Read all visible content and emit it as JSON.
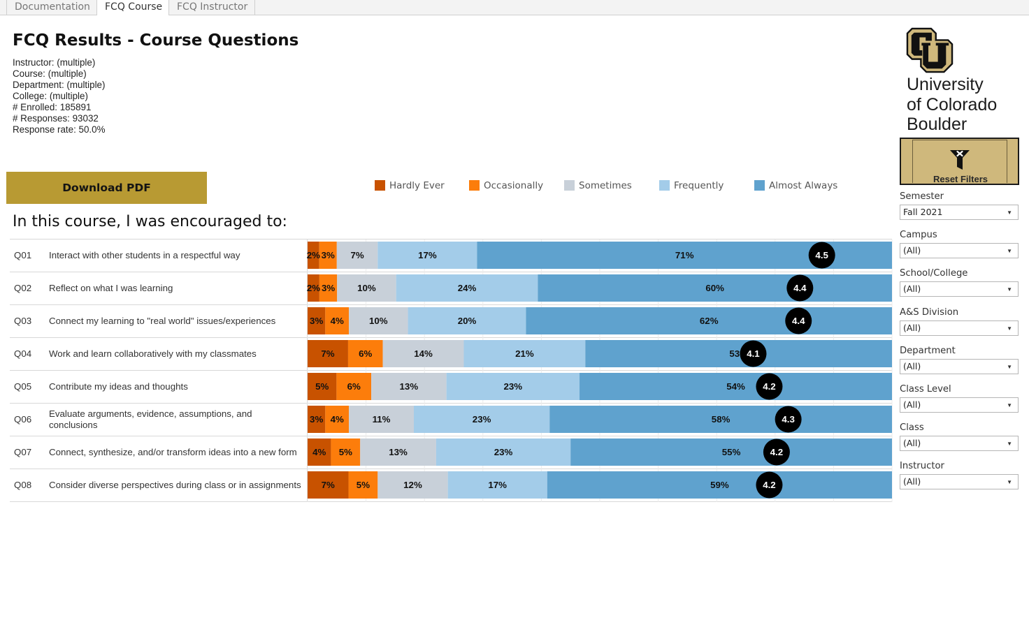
{
  "tabs": [
    {
      "label": "Documentation",
      "active": false
    },
    {
      "label": "FCQ Course",
      "active": true
    },
    {
      "label": "FCQ Instructor",
      "active": false
    }
  ],
  "header": {
    "title": "FCQ Results - Course Questions",
    "info": [
      "Instructor: (multiple)",
      "Course: (multiple)",
      "Department: (multiple)",
      "College: (multiple)",
      "# Enrolled: 185891",
      "# Responses: 93032",
      "Response rate: 50.0%"
    ]
  },
  "download_button": {
    "label": "Download PDF",
    "color": "#B89A33"
  },
  "section_heading": "In this course, I was encouraged to:",
  "logo": {
    "icon": "cu-logo-icon",
    "lines": [
      "University",
      "of Colorado",
      "Boulder"
    ]
  },
  "reset_button": {
    "label": "Reset Filters",
    "icon": "filter-clear-icon",
    "color": "#CFB87C"
  },
  "filters": [
    {
      "label": "Semester",
      "value": "Fall 2021"
    },
    {
      "label": "Campus",
      "value": "(All)"
    },
    {
      "label": "School/College",
      "value": "(All)"
    },
    {
      "label": "A&S Division",
      "value": "(All)"
    },
    {
      "label": "Department",
      "value": "(All)"
    },
    {
      "label": "Class Level",
      "value": "(All)"
    },
    {
      "label": "Class",
      "value": "(All)"
    },
    {
      "label": "Instructor",
      "value": "(All)"
    }
  ],
  "chart_data": {
    "type": "bar",
    "orientation": "horizontal",
    "stacked": true,
    "title": "In this course, I was encouraged to:",
    "xlabel": "",
    "ylabel": "",
    "xlim": [
      0,
      100
    ],
    "grid": true,
    "grid_step": 10,
    "legend": {
      "position": "top"
    },
    "categories": [
      "Q01",
      "Q02",
      "Q03",
      "Q04",
      "Q05",
      "Q06",
      "Q07",
      "Q08"
    ],
    "category_labels": [
      "Interact with other students in a respectful way",
      "Reflect on what I was learning",
      "Connect my learning to \"real world\" issues/experiences",
      "Work and learn collaboratively with my classmates",
      "Contribute my ideas and thoughts",
      "Evaluate arguments, evidence, assumptions, and\nconclusions",
      "Connect, synthesize, and/or transform ideas into a new form",
      "Consider diverse perspectives during class or in assignments"
    ],
    "series": [
      {
        "name": "Hardly Ever",
        "color": "#C85200",
        "values": [
          2,
          2,
          3,
          7,
          5,
          3,
          4,
          7
        ]
      },
      {
        "name": "Occasionally",
        "color": "#FC7D0B",
        "values": [
          3,
          3,
          4,
          6,
          6,
          4,
          5,
          5
        ]
      },
      {
        "name": "Sometimes",
        "color": "#C8D0D9",
        "values": [
          7,
          10,
          10,
          14,
          13,
          11,
          13,
          12
        ]
      },
      {
        "name": "Frequently",
        "color": "#A3CCE9",
        "values": [
          17,
          24,
          20,
          21,
          23,
          23,
          23,
          17
        ]
      },
      {
        "name": "Almost Always",
        "color": "#5FA2CE",
        "values": [
          71,
          60,
          62,
          53,
          54,
          58,
          55,
          59
        ]
      }
    ],
    "mean_scale": [
      1,
      5
    ],
    "means": [
      4.52,
      4.37,
      4.36,
      4.05,
      4.16,
      4.29,
      4.21,
      4.16
    ],
    "mean_labels": [
      "4.5",
      "4.4",
      "4.4",
      "4.1",
      "4.2",
      "4.3",
      "4.2",
      "4.2"
    ],
    "mean_marker_color": "#000000"
  }
}
